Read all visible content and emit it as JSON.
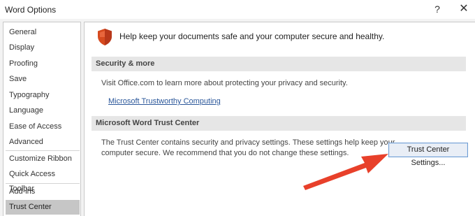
{
  "window": {
    "title": "Word Options",
    "help_glyph": "?",
    "close_glyph": "✕"
  },
  "sidebar": {
    "items": [
      {
        "label": "General",
        "selected": false
      },
      {
        "label": "Display",
        "selected": false
      },
      {
        "label": "Proofing",
        "selected": false
      },
      {
        "label": "Save",
        "selected": false
      },
      {
        "label": "Typography",
        "selected": false
      },
      {
        "label": "Language",
        "selected": false
      },
      {
        "label": "Ease of Access",
        "selected": false
      },
      {
        "label": "Advanced",
        "selected": false
      },
      {
        "label": "Customize Ribbon",
        "selected": false
      },
      {
        "label": "Quick Access Toolbar",
        "selected": false
      },
      {
        "label": "Add-ins",
        "selected": false
      },
      {
        "label": "Trust Center",
        "selected": true
      }
    ]
  },
  "main": {
    "header_icon": "shield-icon",
    "header_text": "Help keep your documents safe and your computer secure and healthy.",
    "security_section": {
      "heading": "Security & more",
      "text": "Visit Office.com to learn more about protecting your privacy and security.",
      "link": "Microsoft Trustworthy Computing"
    },
    "trust_section": {
      "heading": "Microsoft Word Trust Center",
      "text_line1": "The Trust Center contains security and privacy settings. These settings help keep your",
      "text_line2": "computer secure. We recommend that you do not change these settings.",
      "button": "Trust Center Settings..."
    }
  },
  "colors": {
    "shield": "#d64a1f",
    "link": "#2b579a",
    "arrow": "#e8402a",
    "selected_nav": "#c6c6c6"
  }
}
